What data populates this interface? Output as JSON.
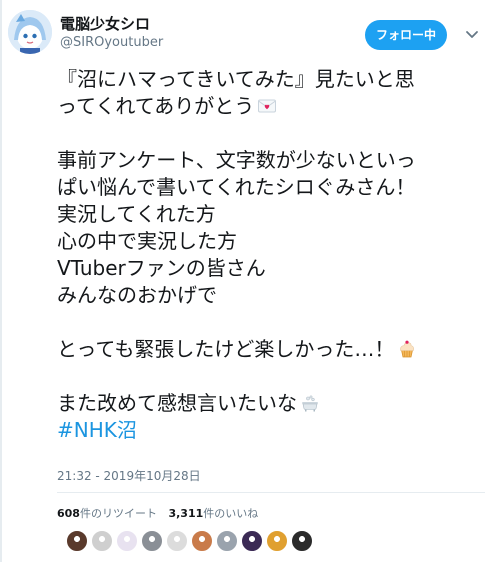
{
  "user": {
    "display_name": "電脳少女シロ",
    "screen_name": "@SIROyoutuber",
    "avatar_icon": "avatar-siro"
  },
  "follow_button": {
    "label": "フォロー中",
    "color": "#1da1f2"
  },
  "menu_icon": "chevron-down-icon",
  "tweet": {
    "lines": [
      "『沼にハマってきいてみた』見たいと思",
      "ってくれてありがとう",
      "",
      "事前アンケート、文字数が少ないといっ",
      "ぱい悩んで書いてくれたシロぐみさん！",
      "実況してくれた方",
      "心の中で実況した方",
      "VTuberファンの皆さん",
      "みんなのおかげで",
      "",
      "とっても緊張したけど楽しかった…！",
      "",
      "また改めて感想言いたいな",
      "#NHK沼"
    ],
    "emoji": {
      "line2": "love-letter-icon",
      "line11": "cupcake-icon",
      "line13": "bathtub-icon"
    },
    "hashtag_color": "#1b95e0",
    "timestamp": "21:32 - 2019年10月28日"
  },
  "stats": {
    "retweets_count": "608",
    "retweets_label": "件のリツイート",
    "likes_count": "3,311",
    "likes_label": "件のいいね"
  },
  "likers": [
    {
      "icon": "liker-avatar-1",
      "color": "#5a3a2c"
    },
    {
      "icon": "liker-avatar-2",
      "color": "#cfcfcf"
    },
    {
      "icon": "liker-avatar-3",
      "color": "#e8e2f0"
    },
    {
      "icon": "liker-avatar-4",
      "color": "#8a8f96"
    },
    {
      "icon": "liker-avatar-5",
      "color": "#dcdcdc"
    },
    {
      "icon": "liker-avatar-6",
      "color": "#c97b4a"
    },
    {
      "icon": "liker-avatar-7",
      "color": "#9aa3ad"
    },
    {
      "icon": "liker-avatar-8",
      "color": "#3b2a55"
    },
    {
      "icon": "liker-avatar-9",
      "color": "#e0a030"
    },
    {
      "icon": "liker-avatar-10",
      "color": "#2b2b2b"
    }
  ]
}
